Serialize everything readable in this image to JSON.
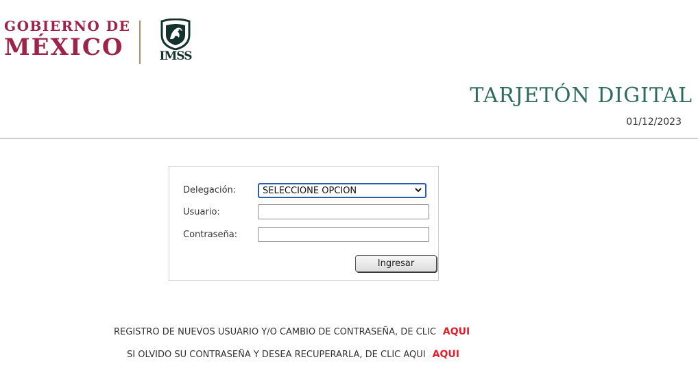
{
  "header": {
    "gob_line1": "GOBIERNO DE",
    "gob_line2": "MÉXICO",
    "imss_logo_text": "IMSS",
    "title": "TARJETÓN DIGITAL",
    "date": "01/12/2023"
  },
  "login": {
    "delegacion_label": "Delegación:",
    "delegacion_selected": "SELECCIONE OPCION",
    "usuario_label": "Usuario:",
    "usuario_value": "",
    "contrasena_label": "Contraseña:",
    "contrasena_value": "",
    "submit_label": "Ingresar"
  },
  "links": {
    "registro_text": "REGISTRO DE NUEVOS USUARIO Y/O CAMBIO DE CONTRASEÑA, DE CLIC",
    "registro_link": "AQUI",
    "recuperar_text": "SI OLVIDO SU CONTRASEÑA Y DESEA RECUPERARLA, DE CLIC AQUI",
    "recuperar_link": "AQUI"
  },
  "colors": {
    "gob_brand": "#9d2449",
    "gold_divider": "#b38e5d",
    "imss_green": "#13322b",
    "title_green": "#2e6b5a",
    "link_red": "#e41f2b",
    "select_focus": "#2a5db0"
  },
  "icons": {
    "imss_emblem": "imss-eagle-emblem-icon",
    "select_arrow": "chevron-down-icon"
  }
}
